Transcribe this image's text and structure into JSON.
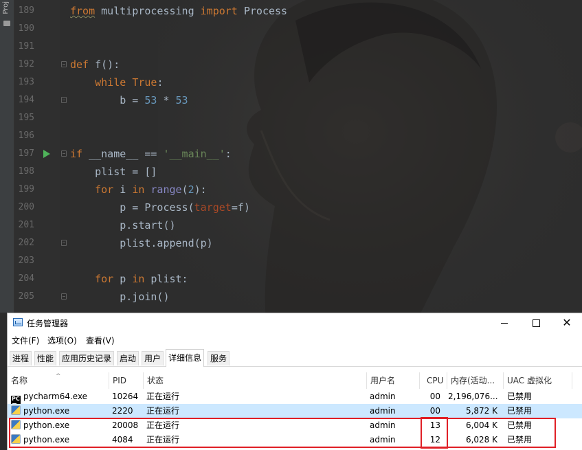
{
  "ide": {
    "project_label": "Proj",
    "lines": [
      {
        "num": "189",
        "tokens": [
          {
            "t": "from",
            "c": "k squig"
          },
          {
            "t": " multiprocessing ",
            "c": ""
          },
          {
            "t": "import",
            "c": "k"
          },
          {
            "t": " Process",
            "c": ""
          }
        ]
      },
      {
        "num": "190",
        "tokens": []
      },
      {
        "num": "191",
        "tokens": []
      },
      {
        "num": "192",
        "tokens": [
          {
            "t": "def",
            "c": "k"
          },
          {
            "t": " f():",
            "c": ""
          }
        ]
      },
      {
        "num": "193",
        "tokens": [
          {
            "t": "    ",
            "c": ""
          },
          {
            "t": "while",
            "c": "k"
          },
          {
            "t": " ",
            "c": ""
          },
          {
            "t": "True",
            "c": "k"
          },
          {
            "t": ":",
            "c": ""
          }
        ]
      },
      {
        "num": "194",
        "tokens": [
          {
            "t": "        b = ",
            "c": ""
          },
          {
            "t": "53",
            "c": "n"
          },
          {
            "t": " * ",
            "c": ""
          },
          {
            "t": "53",
            "c": "n"
          }
        ]
      },
      {
        "num": "195",
        "tokens": []
      },
      {
        "num": "196",
        "tokens": []
      },
      {
        "num": "197",
        "tokens": [
          {
            "t": "if",
            "c": "k"
          },
          {
            "t": " __name__ == ",
            "c": ""
          },
          {
            "t": "'__main__'",
            "c": "s"
          },
          {
            "t": ":",
            "c": ""
          }
        ]
      },
      {
        "num": "198",
        "tokens": [
          {
            "t": "    plist = []",
            "c": ""
          }
        ]
      },
      {
        "num": "199",
        "tokens": [
          {
            "t": "    ",
            "c": ""
          },
          {
            "t": "for",
            "c": "k"
          },
          {
            "t": " i ",
            "c": ""
          },
          {
            "t": "in",
            "c": "k"
          },
          {
            "t": " ",
            "c": ""
          },
          {
            "t": "range",
            "c": "b"
          },
          {
            "t": "(",
            "c": ""
          },
          {
            "t": "2",
            "c": "n"
          },
          {
            "t": "):",
            "c": ""
          }
        ]
      },
      {
        "num": "200",
        "tokens": [
          {
            "t": "        p = Process(",
            "c": ""
          },
          {
            "t": "target",
            "c": "p"
          },
          {
            "t": "=f)",
            "c": ""
          }
        ]
      },
      {
        "num": "201",
        "tokens": [
          {
            "t": "        p.start()",
            "c": ""
          }
        ]
      },
      {
        "num": "202",
        "tokens": [
          {
            "t": "        plist.append(p)",
            "c": ""
          }
        ]
      },
      {
        "num": "203",
        "tokens": []
      },
      {
        "num": "204",
        "tokens": [
          {
            "t": "    ",
            "c": ""
          },
          {
            "t": "for",
            "c": "k"
          },
          {
            "t": " p ",
            "c": ""
          },
          {
            "t": "in",
            "c": "k"
          },
          {
            "t": " plist:",
            "c": ""
          }
        ]
      },
      {
        "num": "205",
        "tokens": [
          {
            "t": "        p.join()",
            "c": ""
          }
        ]
      }
    ]
  },
  "taskmanager": {
    "title": "任务管理器",
    "menu": {
      "file": "文件(F)",
      "options": "选项(O)",
      "view": "查看(V)"
    },
    "tabs": {
      "processes": "进程",
      "performance": "性能",
      "history": "应用历史记录",
      "startup": "启动",
      "users": "用户",
      "details": "详细信息",
      "services": "服务"
    },
    "columns": {
      "name": "名称",
      "pid": "PID",
      "status": "状态",
      "user": "用户名",
      "cpu": "CPU",
      "memory": "内存(活动...",
      "uac": "UAC 虚拟化"
    },
    "rows": [
      {
        "name": "pycharm64.exe",
        "pid": "10264",
        "status": "正在运行",
        "user": "admin",
        "cpu": "00",
        "memory": "2,196,076...",
        "uac": "已禁用"
      },
      {
        "name": "python.exe",
        "pid": "2220",
        "status": "正在运行",
        "user": "admin",
        "cpu": "00",
        "memory": "5,872 K",
        "uac": "已禁用"
      },
      {
        "name": "python.exe",
        "pid": "20008",
        "status": "正在运行",
        "user": "admin",
        "cpu": "13",
        "memory": "6,004 K",
        "uac": "已禁用"
      },
      {
        "name": "python.exe",
        "pid": "4084",
        "status": "正在运行",
        "user": "admin",
        "cpu": "12",
        "memory": "6,028 K",
        "uac": "已禁用"
      }
    ]
  },
  "icons": {
    "run": "run-gutter-icon",
    "fold": "fold-marker-icon",
    "pycharm": "pycharm-app-icon",
    "python": "python-app-icon",
    "taskmanager": "taskmanager-app-icon"
  },
  "colors": {
    "keyword": "#cc7832",
    "number": "#6897bb",
    "string": "#6a8759",
    "builtin": "#8888c6",
    "param": "#aa4926",
    "selection": "#cce8ff",
    "highlight": "#e01f26"
  }
}
